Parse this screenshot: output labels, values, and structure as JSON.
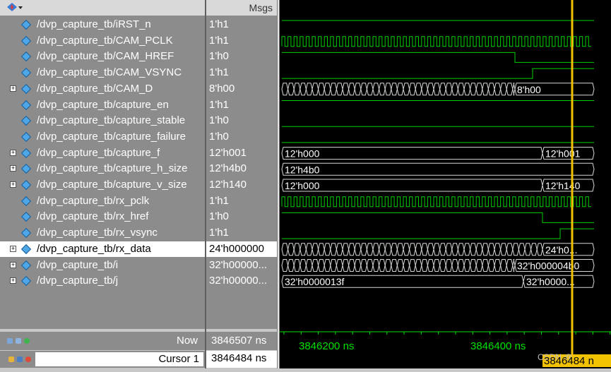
{
  "header": {
    "msgs_label": "Msgs"
  },
  "signals": [
    {
      "name": "/dvp_capture_tb/iRST_n",
      "value": "1'h1",
      "bus": false
    },
    {
      "name": "/dvp_capture_tb/CAM_PCLK",
      "value": "1'h1",
      "bus": false
    },
    {
      "name": "/dvp_capture_tb/CAM_HREF",
      "value": "1'h0",
      "bus": false
    },
    {
      "name": "/dvp_capture_tb/CAM_VSYNC",
      "value": "1'h1",
      "bus": false
    },
    {
      "name": "/dvp_capture_tb/CAM_D",
      "value": "8'h00",
      "bus": true
    },
    {
      "name": "/dvp_capture_tb/capture_en",
      "value": "1'h1",
      "bus": false
    },
    {
      "name": "/dvp_capture_tb/capture_stable",
      "value": "1'h0",
      "bus": false
    },
    {
      "name": "/dvp_capture_tb/capture_failure",
      "value": "1'h0",
      "bus": false
    },
    {
      "name": "/dvp_capture_tb/capture_f",
      "value": "12'h001",
      "bus": true
    },
    {
      "name": "/dvp_capture_tb/capture_h_size",
      "value": "12'h4b0",
      "bus": true
    },
    {
      "name": "/dvp_capture_tb/capture_v_size",
      "value": "12'h140",
      "bus": true
    },
    {
      "name": "/dvp_capture_tb/rx_pclk",
      "value": "1'h1",
      "bus": false
    },
    {
      "name": "/dvp_capture_tb/rx_href",
      "value": "1'h0",
      "bus": false
    },
    {
      "name": "/dvp_capture_tb/rx_vsync",
      "value": "1'h1",
      "bus": false
    },
    {
      "name": "/dvp_capture_tb/rx_data",
      "value": "24'h000000",
      "bus": true,
      "selected": true
    },
    {
      "name": "/dvp_capture_tb/i",
      "value": "32'h00000...",
      "bus": true
    },
    {
      "name": "/dvp_capture_tb/j",
      "value": "32'h00000...",
      "bus": true
    }
  ],
  "wave_labels": {
    "CAM_D": "8'h00",
    "capture_f_a": "12'h000",
    "capture_f_b": "12'h001",
    "capture_h_size": "12'h4b0",
    "capture_v_size_a": "12'h000",
    "capture_v_size_b": "12'h140",
    "rx_data": "24'h0...",
    "i": "32'h000004b0",
    "j_a": "32'h0000013f",
    "j_b": "32'h0000..."
  },
  "footer": {
    "now_label": "Now",
    "now_value": "3846507 ns",
    "cursor_label": "Cursor 1",
    "cursor_value": "3846484 ns",
    "tick1": "3846200 ns",
    "tick2": "3846400 ns",
    "cursor_time": "3846484 n",
    "watermark": "CSDN @"
  },
  "colors": {
    "wave": "#00d000",
    "cursor": "#f2c200",
    "tick": "#00e000"
  }
}
